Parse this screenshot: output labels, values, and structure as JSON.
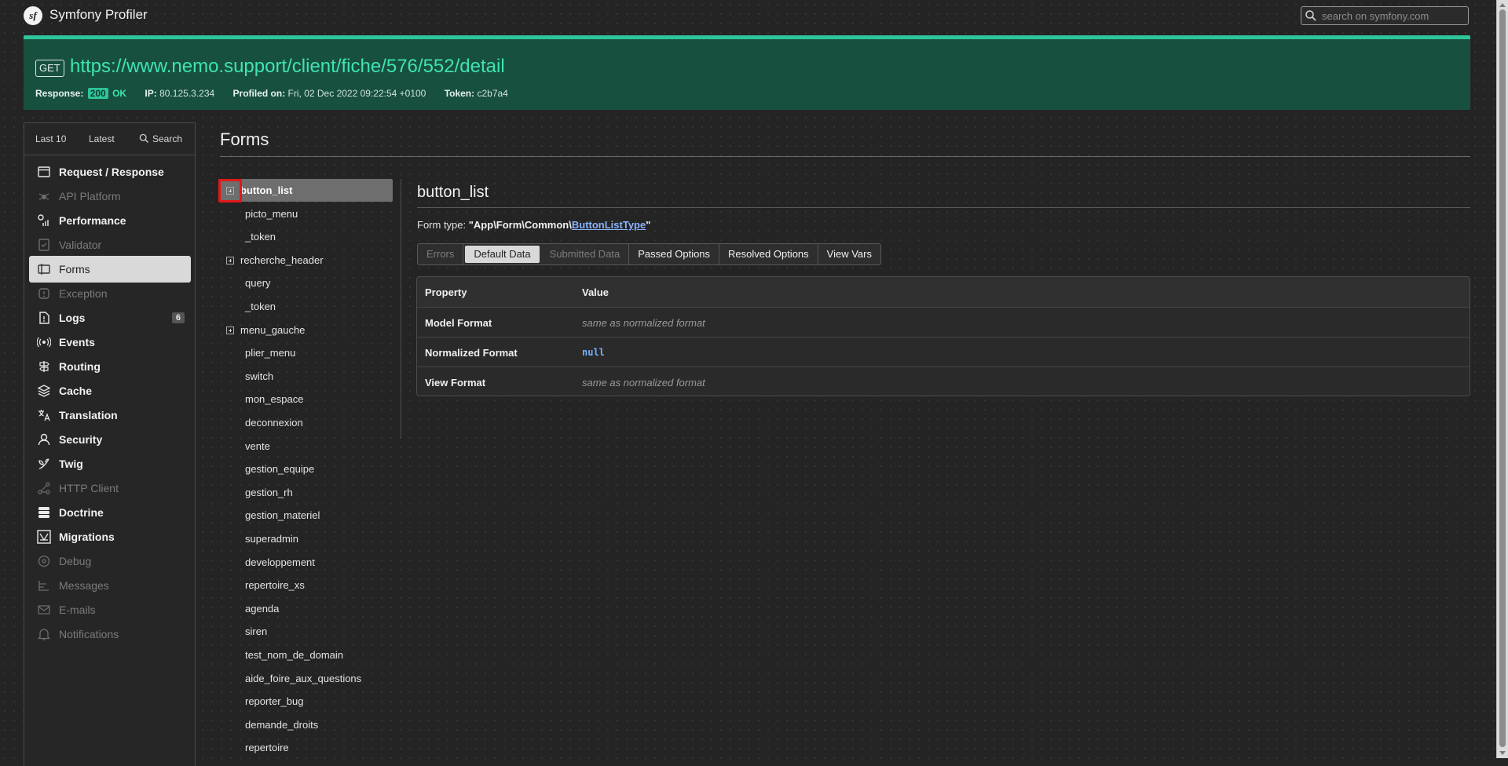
{
  "header": {
    "logo_text": "sf",
    "app_title": "Symfony Profiler",
    "search_placeholder": "search on symfony.com"
  },
  "summary": {
    "method": "GET",
    "url": "https://www.nemo.support/client/fiche/576/552/detail",
    "response_label": "Response:",
    "status_code": "200",
    "status_text": "OK",
    "ip_label": "IP:",
    "ip": "80.125.3.234",
    "profiled_label": "Profiled on:",
    "profiled_on": "Fri, 02 Dec 2022 09:22:54 +0100",
    "token_label": "Token:",
    "token": "c2b7a4"
  },
  "sidebar": {
    "tabs": {
      "last10": "Last 10",
      "latest": "Latest",
      "search": "Search"
    },
    "items": [
      {
        "label": "Request / Response",
        "enabled": true,
        "icon": "request-icon"
      },
      {
        "label": "API Platform",
        "enabled": false,
        "icon": "spider-icon"
      },
      {
        "label": "Performance",
        "enabled": true,
        "icon": "performance-icon"
      },
      {
        "label": "Validator",
        "enabled": false,
        "icon": "validator-icon"
      },
      {
        "label": "Forms",
        "enabled": true,
        "active": true,
        "icon": "forms-icon"
      },
      {
        "label": "Exception",
        "enabled": false,
        "icon": "exception-icon"
      },
      {
        "label": "Logs",
        "enabled": true,
        "badge": "6",
        "icon": "logs-icon"
      },
      {
        "label": "Events",
        "enabled": true,
        "icon": "events-icon"
      },
      {
        "label": "Routing",
        "enabled": true,
        "icon": "routing-icon"
      },
      {
        "label": "Cache",
        "enabled": true,
        "icon": "cache-icon"
      },
      {
        "label": "Translation",
        "enabled": true,
        "icon": "translation-icon"
      },
      {
        "label": "Security",
        "enabled": true,
        "icon": "security-icon"
      },
      {
        "label": "Twig",
        "enabled": true,
        "icon": "twig-icon"
      },
      {
        "label": "HTTP Client",
        "enabled": false,
        "icon": "http-client-icon"
      },
      {
        "label": "Doctrine",
        "enabled": true,
        "icon": "doctrine-icon"
      },
      {
        "label": "Migrations",
        "enabled": true,
        "icon": "migrations-icon"
      },
      {
        "label": "Debug",
        "enabled": false,
        "icon": "debug-icon"
      },
      {
        "label": "Messages",
        "enabled": false,
        "icon": "messages-icon"
      },
      {
        "label": "E-mails",
        "enabled": false,
        "icon": "email-icon"
      },
      {
        "label": "Notifications",
        "enabled": false,
        "icon": "notifications-icon"
      }
    ]
  },
  "main": {
    "title": "Forms",
    "tree": [
      {
        "label": "button_list",
        "level": 0,
        "toggle": true,
        "selected": true
      },
      {
        "label": "picto_menu",
        "level": 1
      },
      {
        "label": "_token",
        "level": 1
      },
      {
        "label": "recherche_header",
        "level": 0,
        "toggle": true
      },
      {
        "label": "query",
        "level": 1
      },
      {
        "label": "_token",
        "level": 1
      },
      {
        "label": "menu_gauche",
        "level": 0,
        "toggle": true
      },
      {
        "label": "plier_menu",
        "level": 1
      },
      {
        "label": "switch",
        "level": 1
      },
      {
        "label": "mon_espace",
        "level": 1
      },
      {
        "label": "deconnexion",
        "level": 1
      },
      {
        "label": "vente",
        "level": 1
      },
      {
        "label": "gestion_equipe",
        "level": 1
      },
      {
        "label": "gestion_rh",
        "level": 1
      },
      {
        "label": "gestion_materiel",
        "level": 1
      },
      {
        "label": "superadmin",
        "level": 1
      },
      {
        "label": "developpement",
        "level": 1
      },
      {
        "label": "repertoire_xs",
        "level": 1
      },
      {
        "label": "agenda",
        "level": 1
      },
      {
        "label": "siren",
        "level": 1
      },
      {
        "label": "test_nom_de_domain",
        "level": 1
      },
      {
        "label": "aide_foire_aux_questions",
        "level": 1
      },
      {
        "label": "reporter_bug",
        "level": 1
      },
      {
        "label": "demande_droits",
        "level": 1
      },
      {
        "label": "repertoire",
        "level": 1
      }
    ],
    "detail": {
      "title": "button_list",
      "form_type_label": "Form type:",
      "form_type_namespace": "App\\Form\\Common\\",
      "form_type_class": "ButtonListType",
      "tabs": [
        {
          "label": "Errors",
          "state": "disabled"
        },
        {
          "label": "Default Data",
          "state": "active"
        },
        {
          "label": "Submitted Data",
          "state": "disabled"
        },
        {
          "label": "Passed Options",
          "state": "normal"
        },
        {
          "label": "Resolved Options",
          "state": "normal"
        },
        {
          "label": "View Vars",
          "state": "normal"
        }
      ],
      "table": {
        "headers": [
          "Property",
          "Value"
        ],
        "rows": [
          {
            "property": "Model Format",
            "value": "same as normalized format",
            "kind": "muted"
          },
          {
            "property": "Normalized Format",
            "value": "null",
            "kind": "code"
          },
          {
            "property": "View Format",
            "value": "same as normalized format",
            "kind": "muted"
          }
        ]
      }
    }
  },
  "colors": {
    "accent": "#2fc49a",
    "summary_bg": "#18503f",
    "url": "#3fe3b2",
    "link": "#8ab4ff",
    "highlight_box": "#e01818"
  }
}
